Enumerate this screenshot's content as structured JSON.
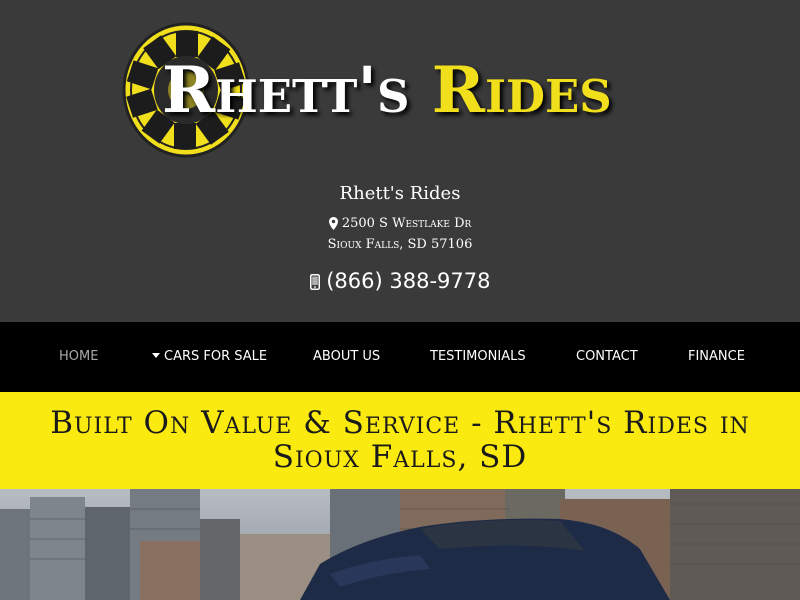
{
  "logo": {
    "word1": "Rhett's",
    "word2": "Rides",
    "emblem_icon": "tire-wheel-icon"
  },
  "business": {
    "name": "Rhett's Rides",
    "address_line1": "2500 S Westlake Dr",
    "address_line2": "Sioux Falls, SD 57106",
    "phone": "(866) 388-9778",
    "address_icon": "map-marker-icon",
    "phone_icon": "mobile-phone-icon"
  },
  "nav": {
    "home": "Home",
    "cars_for_sale": "Cars For Sale",
    "about_us": "About Us",
    "testimonials": "Testimonials",
    "contact": "Contact",
    "finance": "Finance"
  },
  "banner": {
    "line1": "Built On Value & Service - Rhett's Rides in",
    "line2": "Sioux Falls, SD"
  },
  "colors": {
    "header_bg": "#3a3a3a",
    "nav_bg": "#000000",
    "banner_bg": "#fbea0f",
    "brand_yellow": "#f2df1c"
  }
}
